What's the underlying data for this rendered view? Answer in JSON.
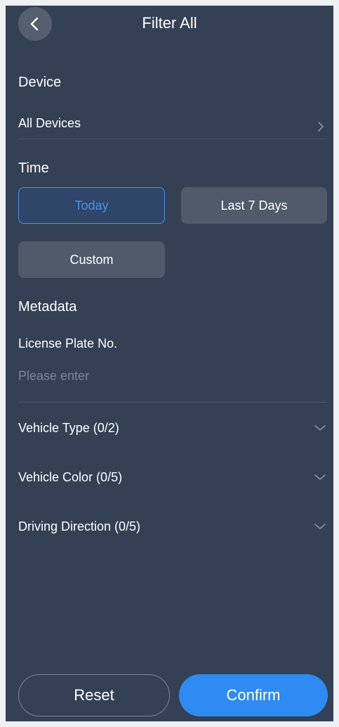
{
  "header": {
    "title": "Filter All",
    "back_icon": "chevron-left-icon"
  },
  "device": {
    "section_title": "Device",
    "value": "All Devices",
    "icon": "chevron-right-icon"
  },
  "time": {
    "section_title": "Time",
    "options": [
      {
        "label": "Today",
        "selected": true
      },
      {
        "label": "Last 7 Days",
        "selected": false
      },
      {
        "label": "Custom",
        "selected": false
      }
    ]
  },
  "metadata": {
    "section_title": "Metadata",
    "license_plate": {
      "label": "License Plate No.",
      "placeholder": "Please enter",
      "value": ""
    },
    "dropdowns": [
      {
        "label": "Vehicle Type (0/2)",
        "icon": "chevron-down-icon"
      },
      {
        "label": "Vehicle Color (0/5)",
        "icon": "chevron-down-icon"
      },
      {
        "label": "Driving Direction (0/5)",
        "icon": "chevron-down-icon"
      }
    ]
  },
  "footer": {
    "reset_label": "Reset",
    "confirm_label": "Confirm"
  },
  "colors": {
    "panel_background": "#344054",
    "accent": "#2f8bf2",
    "selected_text": "#4a8ff5",
    "divider": "#4d5769"
  }
}
